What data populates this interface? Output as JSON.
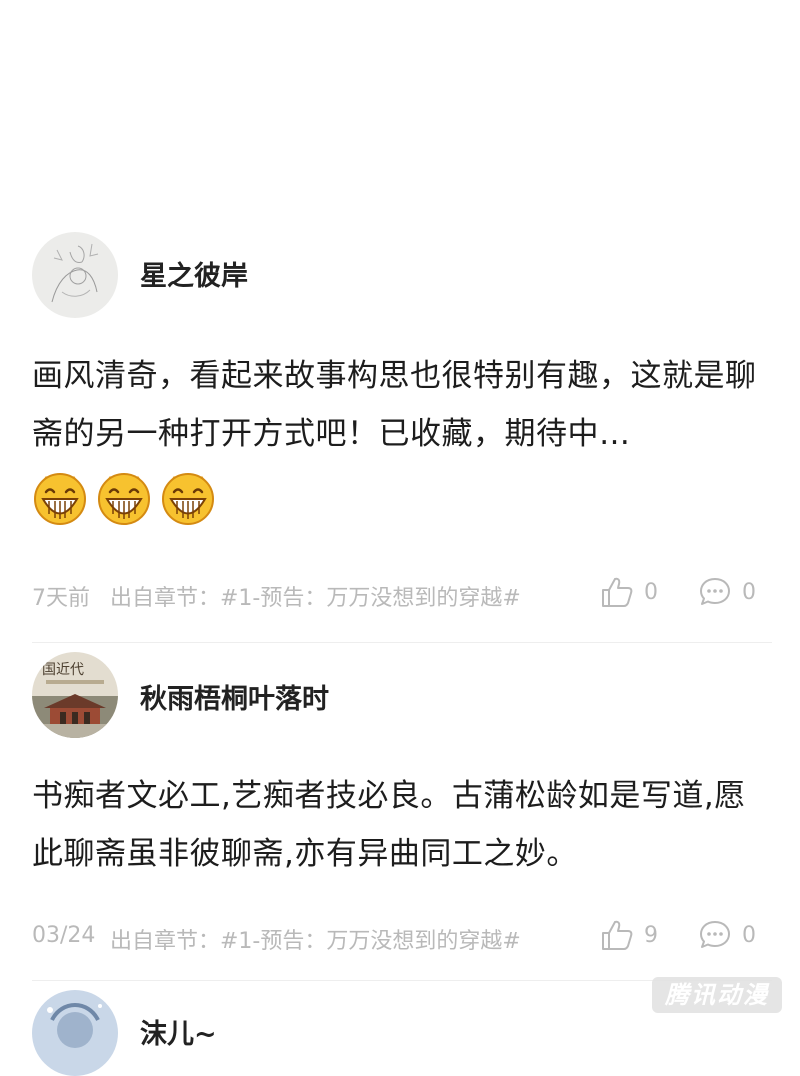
{
  "comments": [
    {
      "username": "星之彼岸",
      "content": "画风清奇，看起来故事构思也很特别有趣，这就是聊斋的另一种打开方式吧！已收藏，期待中…",
      "emoji": [
        "grin-emoji",
        "grin-emoji",
        "grin-emoji"
      ],
      "time": "7天前",
      "chapter": "出自章节：#1-预告：万万没想到的穿越#",
      "likes": "0",
      "replies": "0"
    },
    {
      "username": "秋雨梧桐叶落时",
      "content": "书痴者文必工,艺痴者技必良。古蒲松龄如是写道,愿此聊斋虽非彼聊斋,亦有异曲同工之妙。",
      "time": "03/24",
      "chapter": "出自章节：#1-预告：万万没想到的穿越#",
      "likes": "9",
      "replies": "0"
    },
    {
      "username": "沫儿~"
    }
  ],
  "watermark": "腾讯动漫",
  "colors": {
    "meta_text": "#b9b9b9",
    "username": "#222222",
    "emoji_face": "#f7c22f"
  }
}
